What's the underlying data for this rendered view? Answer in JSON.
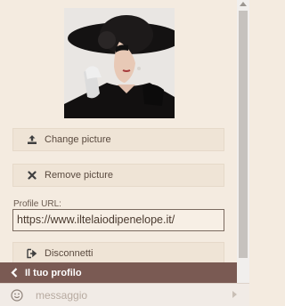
{
  "profile": {
    "avatar_icon": "woman-in-black-hat-portrait",
    "change_picture_label": "Change picture",
    "remove_picture_label": "Remove picture",
    "url_label": "Profile URL:",
    "url_value": "https://www.iltelaiodipenelope.it/",
    "disconnect_label": "Disconnetti"
  },
  "footer": {
    "title": "Il tuo profilo",
    "message_placeholder": "messaggio"
  },
  "colors": {
    "background": "#f4ebe0",
    "button_bg": "#efe4d6",
    "header_bar": "#7a5a53",
    "text": "#5a4a3f"
  },
  "icons": {
    "upload": "upload-icon",
    "remove": "x-icon",
    "disconnect": "sign-out-icon",
    "back": "chevron-left-icon",
    "emoji": "smiley-icon",
    "send": "send-icon"
  }
}
